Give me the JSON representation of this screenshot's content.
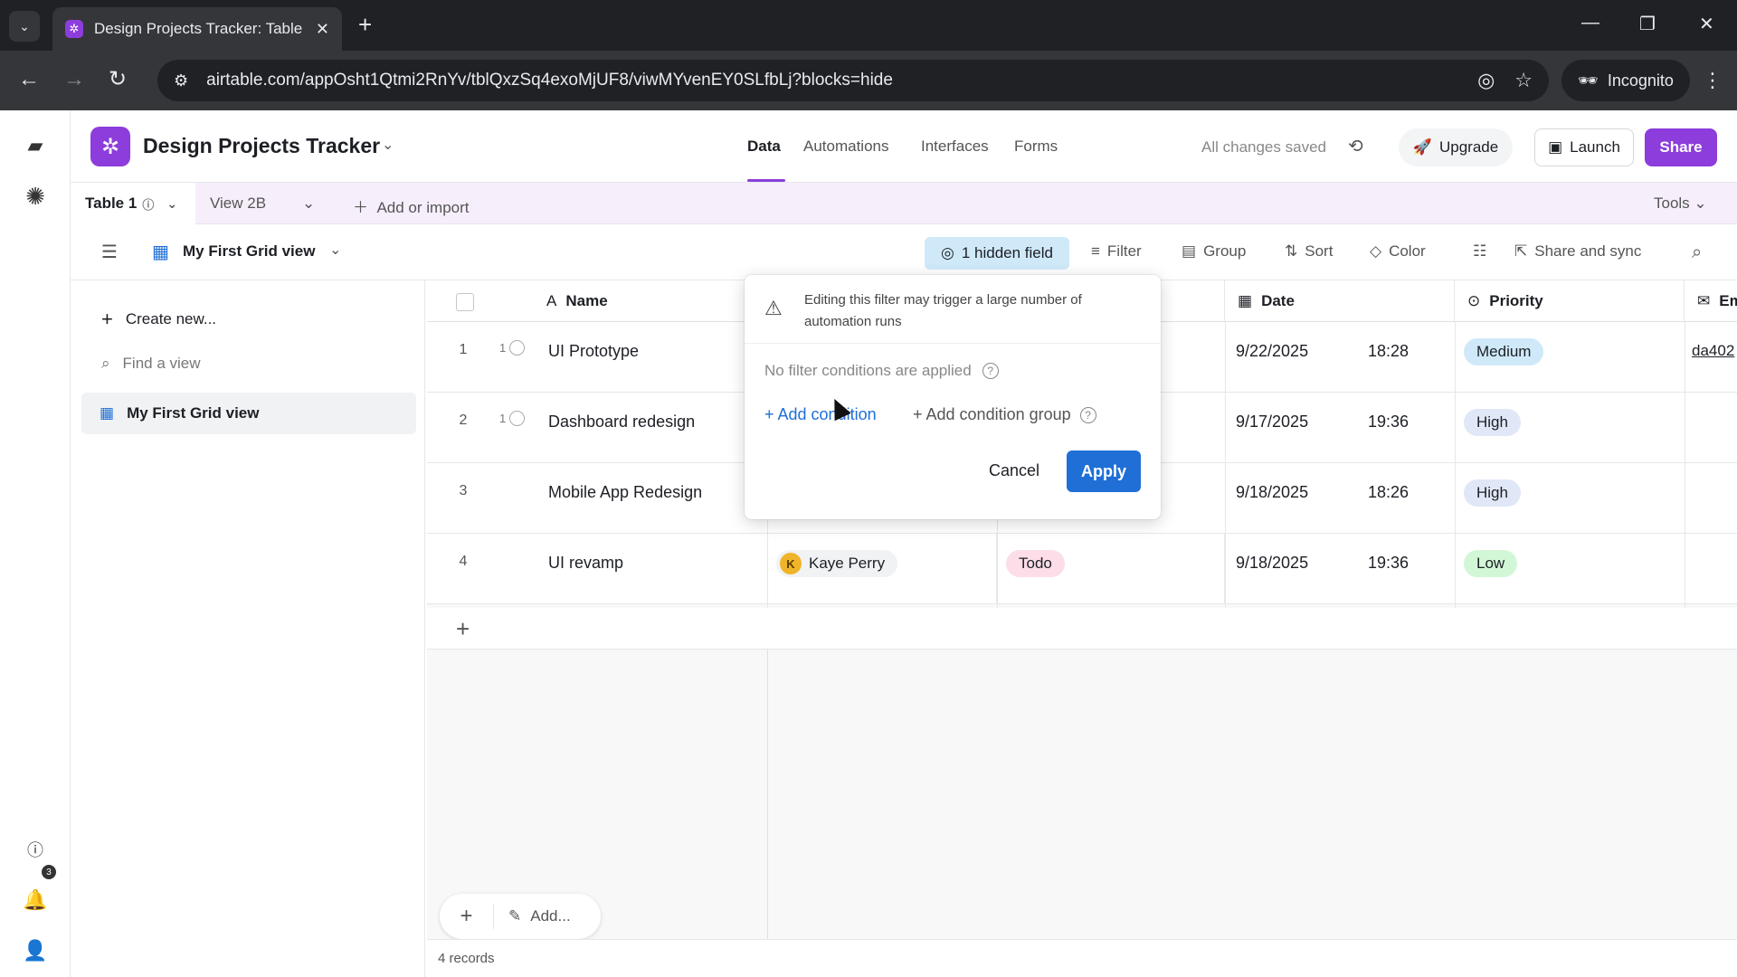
{
  "browser": {
    "tab_title": "Design Projects Tracker: Table 1",
    "url": "airtable.com/appOsht1Qtmi2RnYv/tblQxzSq4exoMjUF8/viwMYvenEY0SLfbLj?blocks=hide",
    "incognito_label": "Incognito"
  },
  "header": {
    "base_name": "Design Projects Tracker",
    "nav": [
      "Data",
      "Automations",
      "Interfaces",
      "Forms"
    ],
    "saved": "All changes saved",
    "upgrade": "Upgrade",
    "launch": "Launch",
    "share": "Share"
  },
  "tablebar": {
    "table_tab": "Table 1",
    "view_tab": "View 2B",
    "add_import": "Add or import",
    "tools": "Tools"
  },
  "viewbar": {
    "view_name": "My First Grid view",
    "hidden_field": "1 hidden field",
    "filter": "Filter",
    "group": "Group",
    "sort": "Sort",
    "color": "Color",
    "share_sync": "Share and sync"
  },
  "sidepanel": {
    "create_new": "Create new...",
    "find_view": "Find a view",
    "active_view": "My First Grid view"
  },
  "grid": {
    "columns": {
      "name": "Name",
      "date": "Date",
      "priority": "Priority",
      "email": "Em"
    },
    "rows": [
      {
        "num": "1",
        "count": "1",
        "name": "UI Prototype",
        "date": "9/22/2025",
        "time": "18:28",
        "priority": "Medium",
        "email": "da402"
      },
      {
        "num": "2",
        "count": "1",
        "name": "Dashboard redesign",
        "date": "9/17/2025",
        "time": "19:36",
        "priority": "High"
      },
      {
        "num": "3",
        "name": "Mobile App Redesign",
        "date": "9/18/2025",
        "time": "18:26",
        "priority": "High"
      },
      {
        "num": "4",
        "name": "UI revamp",
        "assignee": "Kaye Perry",
        "assignee_initial": "K",
        "status": "Todo",
        "date": "9/18/2025",
        "time": "19:36",
        "priority": "Low"
      }
    ],
    "add_label": "Add...",
    "records": "4 records"
  },
  "filter_popover": {
    "warning": "Editing this filter may trigger a large number of automation runs",
    "no_conditions": "No filter conditions are applied",
    "add_condition": "+ Add condition",
    "add_group": "+ Add condition group",
    "cancel": "Cancel",
    "apply": "Apply"
  },
  "rail": {
    "notification_count": "3"
  }
}
